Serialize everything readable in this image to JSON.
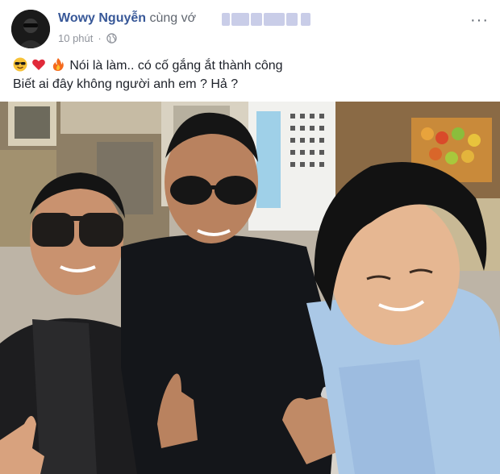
{
  "post": {
    "author": "Wowy Nguyễn",
    "with_label": "cùng vớ",
    "time": "10 phút",
    "separator": "·",
    "more_label": "···",
    "caption_line1": "Nói là làm.. có cố gắng ắt thành công",
    "caption_line2": "Biết ai đây không người anh em ? Hả ?",
    "emojis": [
      "smiling-face-with-sunglasses-icon",
      "red-heart-icon",
      "fire-icon"
    ],
    "privacy_icon": "globe-icon"
  },
  "colors": {
    "author": "#385898",
    "text": "#1d2129",
    "meta": "#90949c"
  }
}
